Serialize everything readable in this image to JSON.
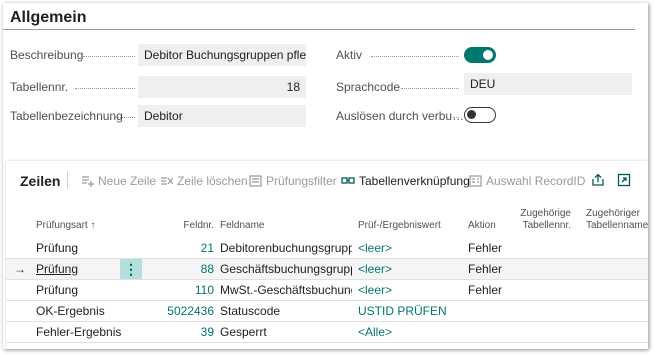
{
  "general": {
    "title": "Allgemein",
    "fields": {
      "beschreibung": {
        "label": "Beschreibung",
        "value": "Debitor Buchungsgruppen pfle…"
      },
      "tabellennr": {
        "label": "Tabellennr.",
        "value": "18"
      },
      "tabellenbezeichnung": {
        "label": "Tabellenbezeichnung",
        "value": "Debitor"
      },
      "aktiv": {
        "label": "Aktiv",
        "value": "on"
      },
      "sprachcode": {
        "label": "Sprachcode",
        "value": "DEU"
      },
      "ausloesen": {
        "label": "Auslösen durch verbu…",
        "value": "off"
      }
    }
  },
  "lines": {
    "title": "Zeilen",
    "toolbar": {
      "neue_zeile": "Neue Zeile",
      "zeile_loeschen": "Zeile löschen",
      "pruefungsfilter": "Prüfungsfilter",
      "tabellenverknuepfung": "Tabellenverknüpfung",
      "auswahl_recordid": "Auswahl RecordID"
    },
    "columns": {
      "pruefungsart": "Prüfungsart ↑",
      "feldnr": "Feldnr.",
      "feldname": "Feldname",
      "pruefwert": "Prüf-/Ergebniswert",
      "aktion": "Aktion",
      "zug_tabellennr_1": "Zugehörige",
      "zug_tabellennr_2": "Tabellennr.",
      "zug_tabellenname_1": "Zugehöriger",
      "zug_tabellenname_2": "Tabellenname"
    },
    "rows": [
      {
        "art": "Prüfung",
        "feldnr": "21",
        "feldname": "Debitorenbuchungsgruppe",
        "wert": "<leer>",
        "aktion": "Fehler"
      },
      {
        "art": "Prüfung",
        "feldnr": "88",
        "feldname": "Geschäftsbuchungsgruppe",
        "wert": "<leer>",
        "aktion": "Fehler",
        "marker": "→"
      },
      {
        "art": "Prüfung",
        "feldnr": "110",
        "feldname": "MwSt.-Geschäftsbuchung…",
        "wert": "<leer>",
        "aktion": "Fehler"
      },
      {
        "art": "OK-Ergebnis",
        "feldnr": "5022436",
        "feldname": "Statuscode",
        "wert": "USTID PRÜFEN",
        "aktion": ""
      },
      {
        "art": "Fehler-Ergebnis",
        "feldnr": "39",
        "feldname": "Gesperrt",
        "wert": "<Alle>",
        "aktion": ""
      }
    ]
  },
  "colors": {
    "accent": "#00776f",
    "selected_row": "#f5f5f5",
    "field_bg": "#efefef"
  }
}
